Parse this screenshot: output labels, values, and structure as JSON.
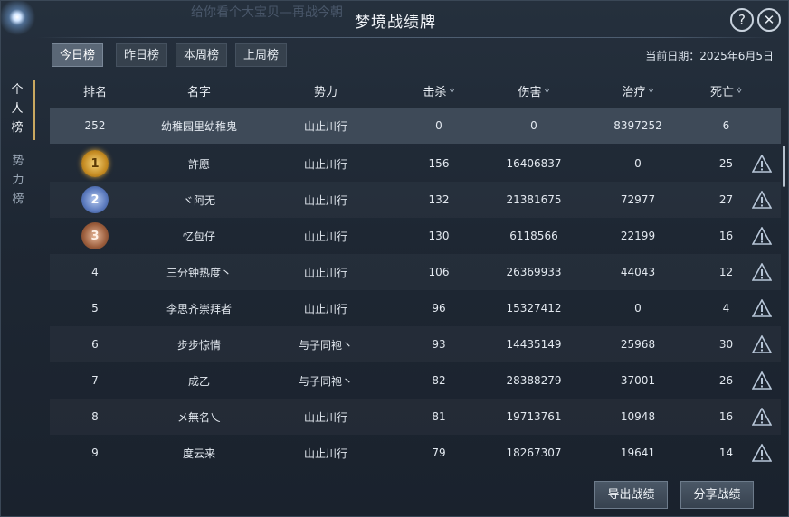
{
  "window": {
    "title": "梦境战绩牌",
    "background_text": "给你看个大宝贝—再战今朝",
    "help_label": "?",
    "close_label": "✕"
  },
  "tabs": [
    {
      "label": "今日榜",
      "active": true
    },
    {
      "label": "昨日榜",
      "active": false
    },
    {
      "label": "本周榜",
      "active": false
    },
    {
      "label": "上周榜",
      "active": false
    }
  ],
  "date_text": "当前日期：2025年6月5日",
  "side_tabs": [
    {
      "chars": [
        "个",
        "人",
        "榜"
      ],
      "active": true
    },
    {
      "chars": [
        "势",
        "力",
        "榜"
      ],
      "active": false
    }
  ],
  "columns": {
    "rank": "排名",
    "name": "名字",
    "faction": "势力",
    "kills": "击杀",
    "damage": "伤害",
    "heal": "治疗",
    "deaths": "死亡"
  },
  "self_row": {
    "rank": "252",
    "name": "幼稚园里幼稚鬼",
    "faction": "山止川行",
    "kills": "0",
    "damage": "0",
    "heal": "8397252",
    "deaths": "6"
  },
  "rows": [
    {
      "rank": "1",
      "name": "許愿",
      "faction": "山止川行",
      "kills": "156",
      "damage": "16406837",
      "heal": "0",
      "deaths": "25"
    },
    {
      "rank": "2",
      "name": "ヾ阿无",
      "faction": "山止川行",
      "kills": "132",
      "damage": "21381675",
      "heal": "72977",
      "deaths": "27"
    },
    {
      "rank": "3",
      "name": "忆包仔",
      "faction": "山止川行",
      "kills": "130",
      "damage": "6118566",
      "heal": "22199",
      "deaths": "16"
    },
    {
      "rank": "4",
      "name": "三分钟热度丶",
      "faction": "山止川行",
      "kills": "106",
      "damage": "26369933",
      "heal": "44043",
      "deaths": "12"
    },
    {
      "rank": "5",
      "name": "李思齐崇拜者",
      "faction": "山止川行",
      "kills": "96",
      "damage": "15327412",
      "heal": "0",
      "deaths": "4"
    },
    {
      "rank": "6",
      "name": "步步惊情",
      "faction": "与子同袍丶",
      "kills": "93",
      "damage": "14435149",
      "heal": "25968",
      "deaths": "30"
    },
    {
      "rank": "7",
      "name": "成乙",
      "faction": "与子同袍丶",
      "kills": "82",
      "damage": "28388279",
      "heal": "37001",
      "deaths": "26"
    },
    {
      "rank": "8",
      "name": "メ無名乀",
      "faction": "山止川行",
      "kills": "81",
      "damage": "19713761",
      "heal": "10948",
      "deaths": "16"
    },
    {
      "rank": "9",
      "name": "度云来",
      "faction": "山止川行",
      "kills": "79",
      "damage": "18267307",
      "heal": "19641",
      "deaths": "14"
    }
  ],
  "buttons": {
    "export": "导出战绩",
    "share": "分享战绩"
  },
  "icons": {
    "sort": "chevron-down-icon",
    "report": "warning-icon",
    "help": "help-icon",
    "close": "close-icon"
  },
  "colors": {
    "accent_gold": "#c9a860",
    "self_row_bg": "#3e4a58",
    "panel_bg": "#1e2733"
  }
}
